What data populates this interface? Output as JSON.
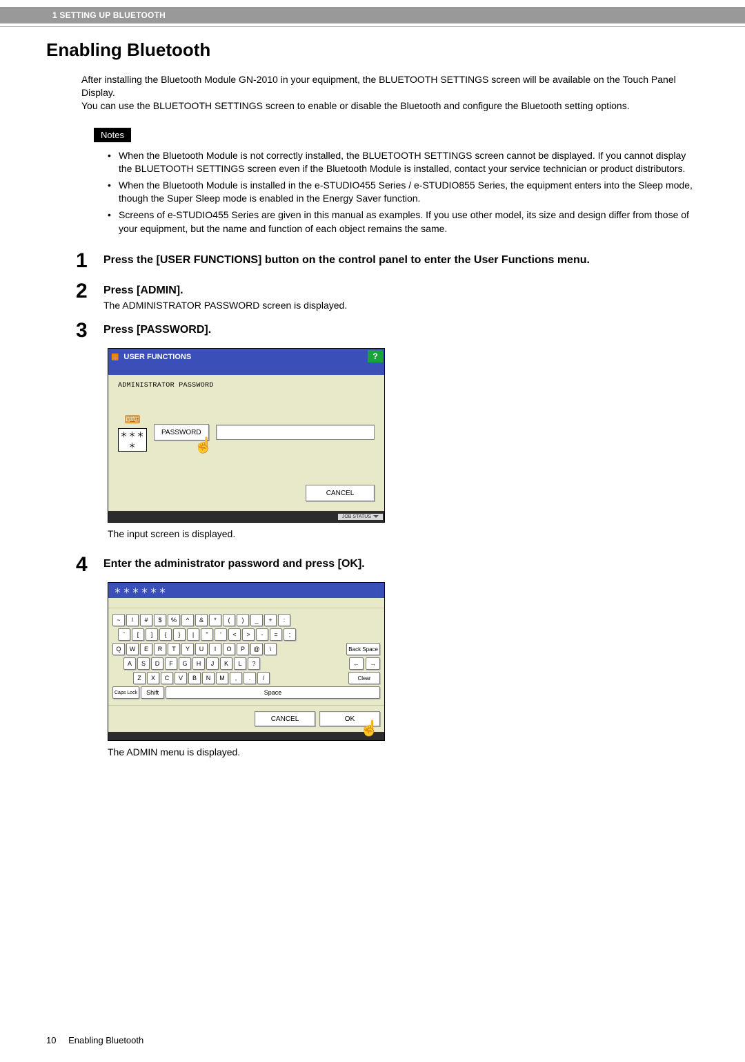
{
  "header_section": "1 SETTING UP BLUETOOTH",
  "title": "Enabling Bluetooth",
  "intro": [
    "After installing the Bluetooth Module GN-2010 in your equipment, the BLUETOOTH SETTINGS screen will be available on the Touch Panel Display.",
    "You can use the BLUETOOTH SETTINGS screen to enable or disable the Bluetooth and configure the Bluetooth setting options."
  ],
  "notes_label": "Notes",
  "notes": [
    "When the Bluetooth Module is not correctly installed, the BLUETOOTH SETTINGS screen cannot be displayed. If you cannot display the BLUETOOTH SETTINGS screen even if the Bluetooth Module is installed, contact your service technician or product distributors.",
    "When the Bluetooth Module is installed in the e-STUDIO455 Series / e-STUDIO855 Series, the equipment enters into the Sleep mode, though the Super Sleep mode is enabled in the Energy Saver function.",
    "Screens of e-STUDIO455 Series are given in this manual as examples. If you use other model, its size and design differ from those of your equipment, but the name and function of each object remains the same."
  ],
  "steps": {
    "s1": {
      "num": "1",
      "title": "Press the [USER FUNCTIONS] button on the control panel to enter the User Functions menu."
    },
    "s2": {
      "num": "2",
      "title": "Press [ADMIN].",
      "sub": "The ADMINISTRATOR PASSWORD screen is displayed."
    },
    "s3": {
      "num": "3",
      "title": "Press [PASSWORD].",
      "caption": "The input screen is displayed."
    },
    "s4": {
      "num": "4",
      "title": "Enter the administrator password and press [OK].",
      "caption": "The ADMIN menu is displayed."
    }
  },
  "screen1": {
    "titlebar": "USER FUNCTIONS",
    "help": "?",
    "label": "ADMINISTRATOR PASSWORD",
    "mask": "＊＊＊＊",
    "pw_btn": "PASSWORD",
    "cancel": "CANCEL",
    "jobstatus": "JOB STATUS"
  },
  "screen2": {
    "title_mask": "＊＊＊＊＊＊",
    "row1": [
      "~",
      "!",
      "#",
      "$",
      "%",
      "^",
      "&",
      "*",
      "(",
      ")",
      "_",
      "+",
      ":"
    ],
    "row2": [
      "`",
      "[",
      "]",
      "{",
      "}",
      "|",
      "\"",
      "'",
      "<",
      ">",
      "-",
      "=",
      ";"
    ],
    "row3": [
      "Q",
      "W",
      "E",
      "R",
      "T",
      "Y",
      "U",
      "I",
      "O",
      "P",
      "@",
      "\\"
    ],
    "row4": [
      "A",
      "S",
      "D",
      "F",
      "G",
      "H",
      "J",
      "K",
      "L",
      "?"
    ],
    "row5": [
      "Z",
      "X",
      "C",
      "V",
      "B",
      "N",
      "M",
      ",",
      ".",
      "/"
    ],
    "backspace": "Back Space",
    "left": "←",
    "right": "→",
    "clear": "Clear",
    "capslock": "Caps Lock",
    "shift": "Shift",
    "space": "Space",
    "cancel": "CANCEL",
    "ok": "OK"
  },
  "footer": {
    "page": "10",
    "title": "Enabling Bluetooth"
  }
}
